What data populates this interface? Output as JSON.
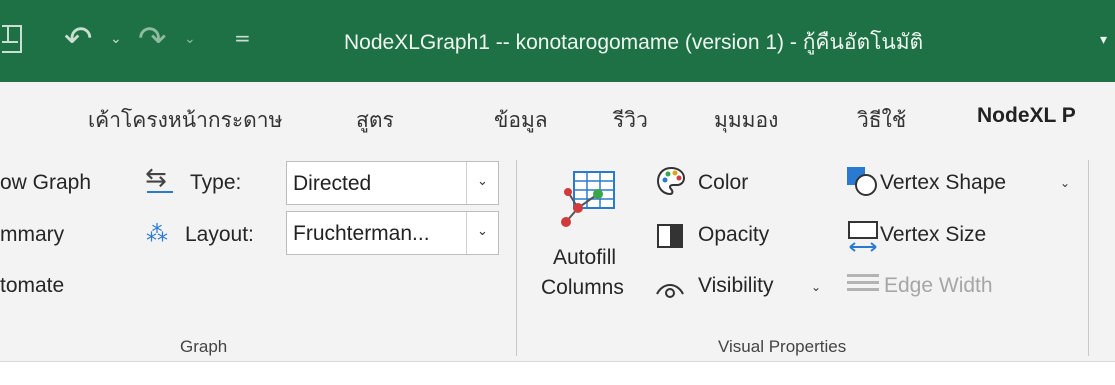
{
  "window": {
    "title": "NodeXLGraph1 -- konotarogomame (version 1)  -  กู้คืนอัตโนมัติ",
    "qat_customize": "=",
    "icons": [
      "save-icon",
      "undo-icon",
      "redo-icon",
      "customize-qat-icon"
    ]
  },
  "tabs": [
    {
      "label": "เค้าโครงหน้ากระดาษ"
    },
    {
      "label": "สูตร"
    },
    {
      "label": "ข้อมูล"
    },
    {
      "label": "รีวิว"
    },
    {
      "label": "มุมมอง"
    },
    {
      "label": "วิธีใช้"
    },
    {
      "label": "NodeXL P",
      "active": true
    }
  ],
  "graph_group": {
    "label": "Graph",
    "show_graph": "ow Graph",
    "summary": "mmary",
    "automate": "tomate",
    "type_label": "Type:",
    "type_value": "Directed",
    "layout_label": "Layout:",
    "layout_value": "Fruchterman..."
  },
  "visual_group": {
    "label": "Visual Properties",
    "autofill_line1": "Autofill",
    "autofill_line2": "Columns",
    "color": "Color",
    "opacity": "Opacity",
    "visibility": "Visibility",
    "vertex_shape": "Vertex Shape",
    "vertex_size": "Vertex Size",
    "edge_width": "Edge Width"
  },
  "colors": {
    "titlebar": "#1e7145",
    "ribbon": "#f3f3f3",
    "accent_blue": "#2a7ad2"
  }
}
